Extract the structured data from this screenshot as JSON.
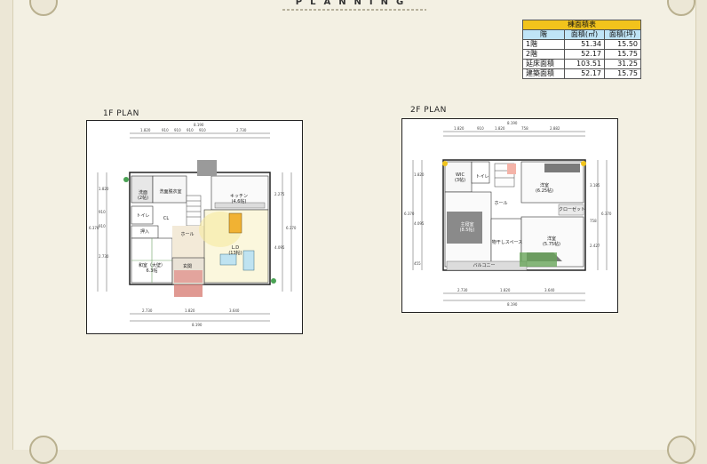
{
  "title": "PLANNING",
  "area_table": {
    "caption": "棟面積表",
    "headers": [
      "階",
      "面積(㎡)",
      "面積(坪)"
    ],
    "rows": [
      {
        "floor": "1階",
        "sqm": "51.34",
        "tsubo": "15.50"
      },
      {
        "floor": "2階",
        "sqm": "52.17",
        "tsubo": "15.75"
      },
      {
        "floor": "延床面積",
        "sqm": "103.51",
        "tsubo": "31.25"
      },
      {
        "floor": "建築面積",
        "sqm": "52.17",
        "tsubo": "15.75"
      }
    ]
  },
  "plan1": {
    "label": "1F PLAN",
    "rooms": {
      "wash": "洗面",
      "wash_area": "(2帖)",
      "dressing": "洗面脱衣室",
      "kitchen": "キッチン",
      "kitchen_area": "(4.6帖)",
      "toilet": "トイレ",
      "hall": "ホール",
      "oshiire": "押入",
      "washitsu": "和室（大壁）",
      "washitsu_area": "6.3帖",
      "ld": "L.D",
      "ld_area": "(13帖)",
      "entrance": "玄関",
      "closet": "CL"
    },
    "dims_top": [
      "1.820",
      "910",
      "910",
      "910",
      "910",
      "2.730"
    ],
    "total_top": "8.190",
    "dims_bottom": [
      "2.730",
      "1.820",
      "3.640"
    ],
    "total_bottom": "8.190",
    "dims_left": [
      "1.820",
      "910",
      "910",
      "2.730"
    ],
    "total_left": "6.370",
    "dims_right": [
      "2.275",
      "4.095"
    ],
    "total_right": "6.370"
  },
  "plan2": {
    "label": "2F PLAN",
    "rooms": {
      "wic": "WIC",
      "wic_area": "(3帖)",
      "toilet": "トイレ",
      "yoshitsu1": "洋室",
      "yoshitsu1_area": "(6.25帖)",
      "hall": "ホール",
      "master": "主寝室",
      "master_area": "(8.5帖)",
      "drying": "物干しスペース",
      "yoshitsu2": "洋室",
      "yoshitsu2_area": "(5.75帖)",
      "closet": "クローゼット",
      "balcony": "バルコニー"
    },
    "dims_top": [
      "1.820",
      "910",
      "1.820",
      "758",
      "2.882"
    ],
    "total_top": "8.190",
    "dims_bottom": [
      "2.730",
      "1.820",
      "3.640"
    ],
    "total_bottom": "8.190",
    "dims_left": [
      "1.820",
      "4.095",
      "455"
    ],
    "total_left": "6.370",
    "dims_right": [
      "3.185",
      "758",
      "2.427"
    ],
    "total_right": "6.370"
  }
}
